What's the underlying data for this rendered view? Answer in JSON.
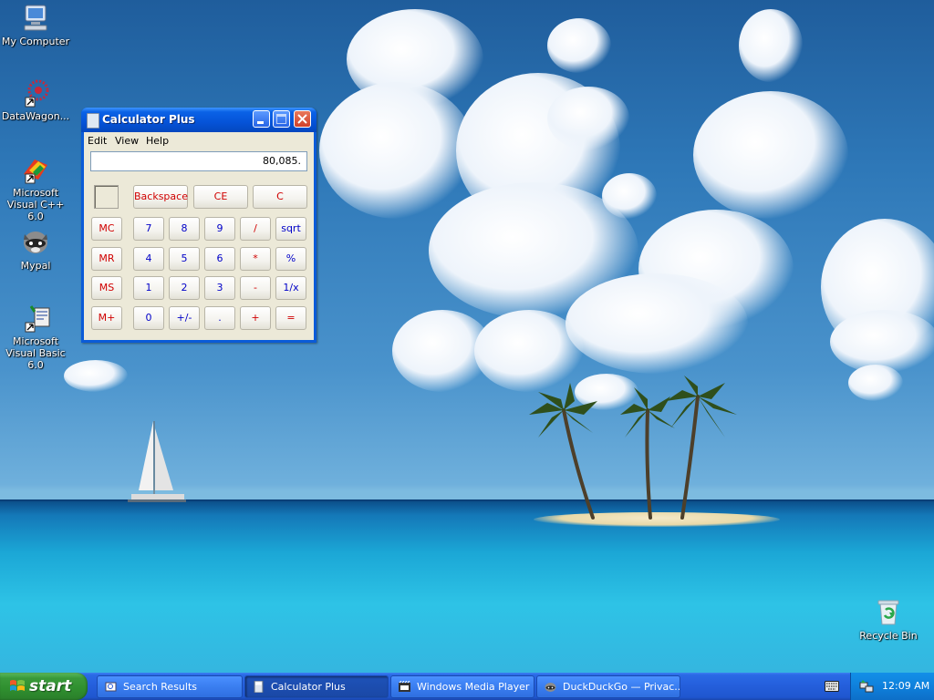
{
  "desktop": {
    "icons": [
      {
        "label": "My Computer"
      },
      {
        "label": "DataWagon..."
      },
      {
        "label": "Microsoft Visual C++ 6.0"
      },
      {
        "label": "Mypal"
      },
      {
        "label": "Microsoft Visual Basic 6.0"
      },
      {
        "label": "Recycle Bin"
      }
    ]
  },
  "calculator": {
    "title": "Calculator Plus",
    "menu": [
      "Edit",
      "View",
      "Help"
    ],
    "display": "80,085.",
    "keys": {
      "backspace": "Backspace",
      "ce": "CE",
      "c": "C",
      "mc": "MC",
      "mr": "MR",
      "ms": "MS",
      "mplus": "M+",
      "n7": "7",
      "n8": "8",
      "n9": "9",
      "div": "/",
      "sqrt": "sqrt",
      "n4": "4",
      "n5": "5",
      "n6": "6",
      "mul": "*",
      "pct": "%",
      "n1": "1",
      "n2": "2",
      "n3": "3",
      "sub": "-",
      "inv": "1/x",
      "n0": "0",
      "sign": "+/-",
      "dot": ".",
      "add": "+",
      "eq": "="
    }
  },
  "taskbar": {
    "start": "start",
    "tasks": [
      {
        "label": "Search Results"
      },
      {
        "label": "Calculator Plus"
      },
      {
        "label": "Windows Media Player"
      },
      {
        "label": "DuckDuckGo — Privac..."
      }
    ],
    "clock": "12:09 AM"
  }
}
